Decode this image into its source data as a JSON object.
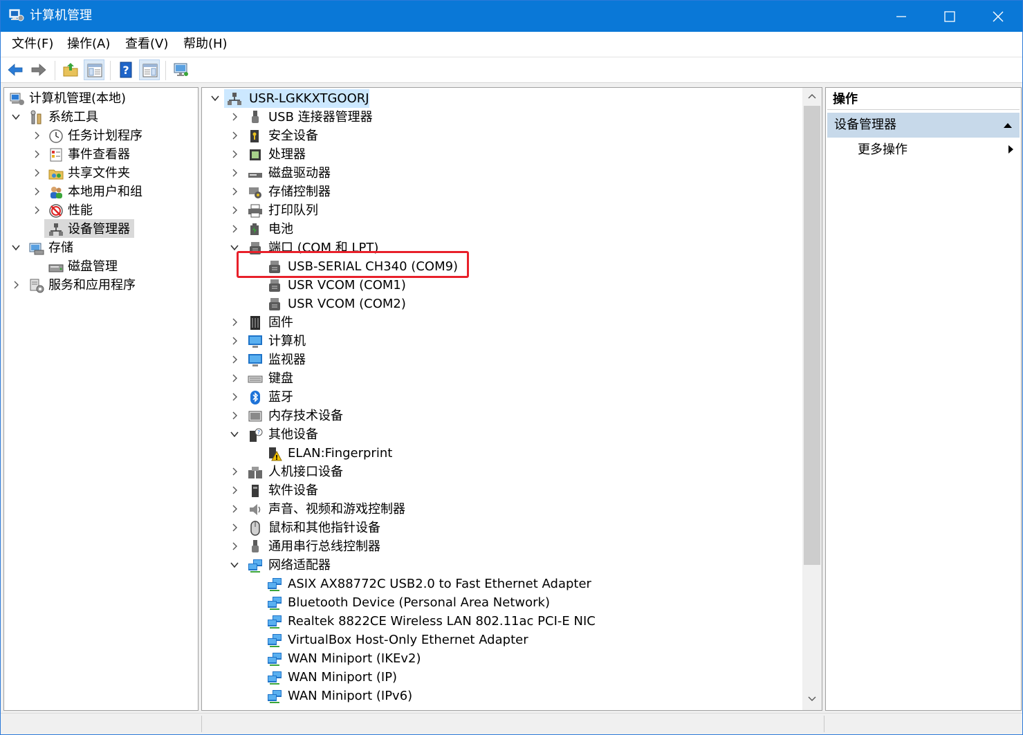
{
  "window": {
    "title": "计算机管理"
  },
  "menu": [
    "文件(F)",
    "操作(A)",
    "查看(V)",
    "帮助(H)"
  ],
  "toolbar": {
    "buttons": [
      "back-icon",
      "forward-icon",
      "up-folder-icon",
      "show-tree-icon",
      "help-icon",
      "show-actions-icon",
      "monitor-icon"
    ],
    "selected": [
      "show-tree-icon",
      "show-actions-icon"
    ]
  },
  "left_tree": [
    {
      "label": "计算机管理(本地)",
      "icon": "computer-management-icon"
    },
    {
      "label": "系统工具",
      "icon": "tools-icon",
      "expanded": true
    },
    {
      "label": "任务计划程序",
      "icon": "clock-icon"
    },
    {
      "label": "事件查看器",
      "icon": "event-viewer-icon"
    },
    {
      "label": "共享文件夹",
      "icon": "shared-folder-icon"
    },
    {
      "label": "本地用户和组",
      "icon": "users-icon"
    },
    {
      "label": "性能",
      "icon": "performance-icon"
    },
    {
      "label": "设备管理器",
      "icon": "device-manager-icon",
      "selected": true
    },
    {
      "label": "存储",
      "icon": "storage-icon",
      "expanded": true
    },
    {
      "label": "磁盘管理",
      "icon": "disk-management-icon"
    },
    {
      "label": "服务和应用程序",
      "icon": "services-icon"
    }
  ],
  "device_tree": {
    "root": "USR-LGKKXTGOORJ",
    "items": [
      {
        "label": "USB 连接器管理器",
        "icon": "usb-connector-icon"
      },
      {
        "label": "安全设备",
        "icon": "security-device-icon"
      },
      {
        "label": "处理器",
        "icon": "processor-icon"
      },
      {
        "label": "磁盘驱动器",
        "icon": "disk-drive-icon"
      },
      {
        "label": "存储控制器",
        "icon": "storage-controller-icon"
      },
      {
        "label": "打印队列",
        "icon": "printer-icon"
      },
      {
        "label": "电池",
        "icon": "battery-icon"
      },
      {
        "label": "端口 (COM 和 LPT)",
        "icon": "port-icon",
        "expanded": true
      },
      {
        "label": "USB-SERIAL CH340 (COM9)",
        "icon": "port-icon",
        "child": true,
        "highlighted": true
      },
      {
        "label": "USR VCOM (COM1)",
        "icon": "port-icon",
        "child": true
      },
      {
        "label": "USR VCOM (COM2)",
        "icon": "port-icon",
        "child": true
      },
      {
        "label": "固件",
        "icon": "firmware-icon"
      },
      {
        "label": "计算机",
        "icon": "computer-icon"
      },
      {
        "label": "监视器",
        "icon": "monitor-icon"
      },
      {
        "label": "键盘",
        "icon": "keyboard-icon"
      },
      {
        "label": "蓝牙",
        "icon": "bluetooth-icon"
      },
      {
        "label": "内存技术设备",
        "icon": "memory-device-icon"
      },
      {
        "label": "其他设备",
        "icon": "other-device-icon",
        "expanded": true
      },
      {
        "label": "ELAN:Fingerprint",
        "icon": "warning-device-icon",
        "child": true
      },
      {
        "label": "人机接口设备",
        "icon": "hid-icon"
      },
      {
        "label": "软件设备",
        "icon": "software-device-icon"
      },
      {
        "label": "声音、视频和游戏控制器",
        "icon": "sound-icon"
      },
      {
        "label": "鼠标和其他指针设备",
        "icon": "mouse-icon"
      },
      {
        "label": "通用串行总线控制器",
        "icon": "usb-controller-icon"
      },
      {
        "label": "网络适配器",
        "icon": "network-adapter-icon",
        "expanded": true
      },
      {
        "label": "ASIX AX88772C USB2.0 to Fast Ethernet Adapter",
        "icon": "network-adapter-icon",
        "child": true
      },
      {
        "label": "Bluetooth Device (Personal Area Network)",
        "icon": "network-adapter-icon",
        "child": true
      },
      {
        "label": "Realtek 8822CE Wireless LAN 802.11ac PCI-E NIC",
        "icon": "network-adapter-icon",
        "child": true
      },
      {
        "label": "VirtualBox Host-Only Ethernet Adapter",
        "icon": "network-adapter-icon",
        "child": true
      },
      {
        "label": "WAN Miniport (IKEv2)",
        "icon": "network-adapter-icon",
        "child": true
      },
      {
        "label": "WAN Miniport (IP)",
        "icon": "network-adapter-icon",
        "child": true
      },
      {
        "label": "WAN Miniport (IPv6)",
        "icon": "network-adapter-icon",
        "child": true
      }
    ]
  },
  "actions": {
    "header": "操作",
    "group": "设备管理器",
    "more": "更多操作"
  },
  "colors": {
    "titlebar": "#0a78d7",
    "highlight_box": "#e8202a",
    "selection": "#cce8ff",
    "actions_group": "#c7d9ea"
  }
}
